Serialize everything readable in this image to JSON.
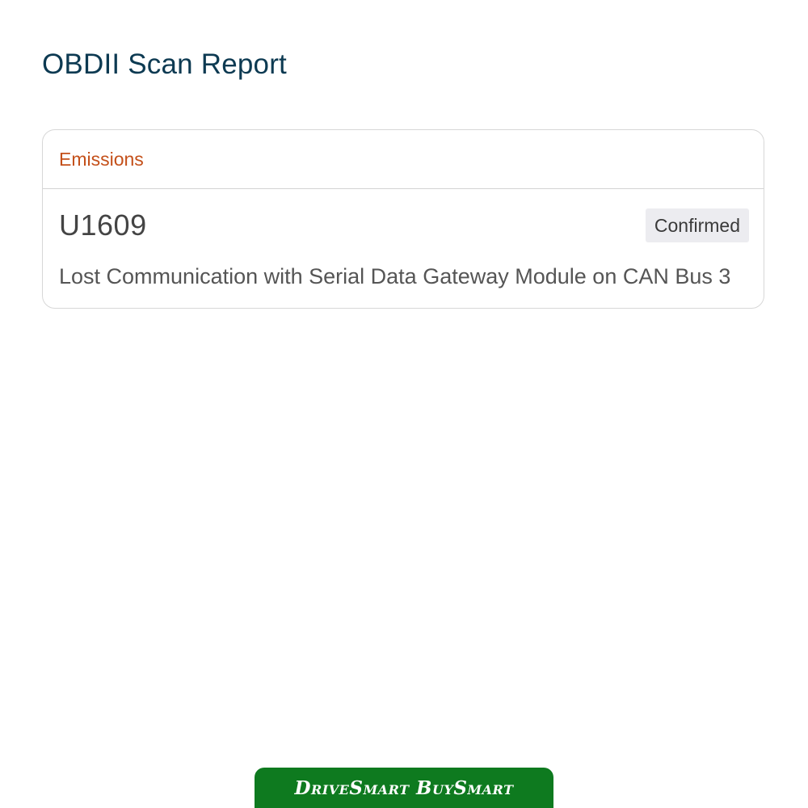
{
  "header": {
    "title": "OBDII Scan Report"
  },
  "report": {
    "category": "Emissions",
    "code": "U1609",
    "status": "Confirmed",
    "description": "Lost Communication with Serial Data Gateway Module on CAN Bus 3"
  },
  "footer": {
    "brand": "DriveSmart BuySmart",
    "brand_color": "#0e7a1f"
  },
  "colors": {
    "title": "#0d3a52",
    "category": "#c4501a",
    "badge_bg": "#ececf0"
  }
}
